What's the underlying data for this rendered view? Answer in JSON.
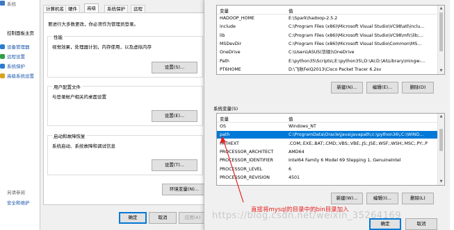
{
  "control_panel": {
    "title": "系统",
    "home_link": "控制面板主页",
    "items": [
      {
        "label": "设备管理器",
        "icon": "device-manager-icon",
        "color": "#2b7bd0"
      },
      {
        "label": "远程设置",
        "icon": "remote-settings-icon",
        "color": "#2f9e44"
      },
      {
        "label": "系统保护",
        "icon": "system-protection-icon",
        "color": "#2b7bd0"
      },
      {
        "label": "高级系统设置",
        "icon": "advanced-settings-icon",
        "color": "#d9a21b"
      }
    ],
    "see_also": "另请参阅",
    "security_link": "安全和维护"
  },
  "system_properties": {
    "tabs": [
      "计算机名",
      "硬件",
      "高级",
      "系统保护",
      "远程"
    ],
    "active_tab": "高级",
    "admin_note": "要进行大多数更改，你必须作为管理员登录。",
    "performance": {
      "title": "性能",
      "desc": "视觉效果，处理器计划，内存使用，以及虚拟内存",
      "button": "设置(S)..."
    },
    "user_profiles": {
      "title": "用户配置文件",
      "desc": "与登录帐户相关的桌面设置",
      "button": "设置(E)..."
    },
    "startup_recovery": {
      "title": "启动和故障恢复",
      "desc": "系统启动、系统故障和调试信息",
      "button": "设置(T)..."
    },
    "env_button": "环境变量(N)...",
    "ok_button": "确定",
    "cancel_button": "取消",
    "apply_button": "应用(A)"
  },
  "environment_variables": {
    "user_vars": {
      "col_var": "变量",
      "col_val": "值",
      "rows": [
        {
          "name": "HADOOP_HOME",
          "value": "E:\\Spark\\hadoop-2.5.2"
        },
        {
          "name": "include",
          "value": "C:\\Program Files (x86)\\Microsoft Visual Studio\\VC98\\atl\\inclu..."
        },
        {
          "name": "lib",
          "value": "C:\\Program Files (x86)\\Microsoft Visual Studio\\VC98\\mfc\\lib;..."
        },
        {
          "name": "MSDevDir",
          "value": "C:\\Program Files (x86)\\Microsoft Visual Studio\\Common\\MS..."
        },
        {
          "name": "OneDrive",
          "value": "C:\\Users\\ASUS(华硕)\\OneDrive"
        },
        {
          "name": "Path",
          "value": "E:\\python35\\Scripts\\;E:\\python35\\;D:\\AI;D:\\AI\\Library\\mingw-..."
        },
        {
          "name": "PT6HOME",
          "value": "D:\\飞秋FeiQ2013\\Cisco Packet Tracer 6.2sv"
        }
      ],
      "new_button": "新建(N)...",
      "edit_button": "编辑(E)...",
      "delete_button": "删除(D)"
    },
    "system_vars": {
      "title": "系统变量(S)",
      "col_var": "变量",
      "col_val": "值",
      "rows": [
        {
          "name": "OS",
          "value": "Windows_NT"
        },
        {
          "name": "path",
          "value": "C:\\ProgramData\\Oracle\\Java\\javapath;c:\\python36\\;C:\\WIND..."
        },
        {
          "name": "PATHEXT",
          "value": ".COM;.EXE;.BAT;.CMD;.VBS;.VBE;.JS;.JSE;.WSF;.WSH;.MSC;.PY;.P"
        },
        {
          "name": "PROCESSOR_ARCHITECT",
          "value": "AMD64"
        },
        {
          "name": "PROCESSOR_IDENTIFIER",
          "value": "Intel64 Family 6 Model 69 Stepping 1, GenuineIntel"
        },
        {
          "name": "PROCESSOR_LEVEL",
          "value": "6"
        },
        {
          "name": "PROCESSOR_REVISION",
          "value": "4501"
        }
      ],
      "selected_index": 1,
      "new_button": "新建(W)...",
      "edit_button": "编辑(I)...",
      "delete_button": "删除(L)"
    },
    "ok_button": "确定",
    "cancel_button": "取消"
  },
  "annotation": {
    "text": "直接将mysql的目录中的bin目录加入",
    "color": "#e62121"
  },
  "watermark": "https://blog.csdn.net/weixin_35264169"
}
